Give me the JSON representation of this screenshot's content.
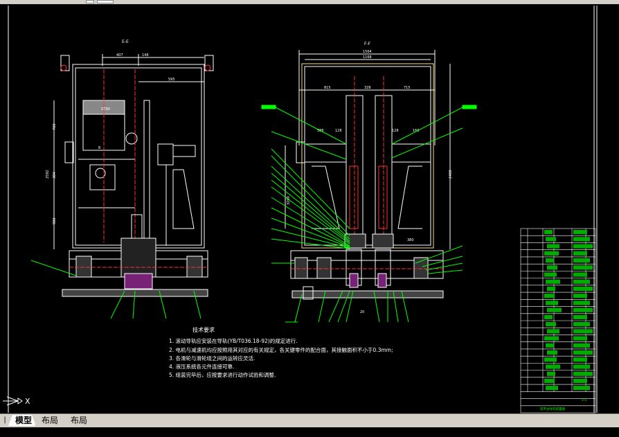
{
  "app": {
    "toolbar_icons": [
      "toolbar-button-icon",
      "toolbar-field"
    ]
  },
  "views": {
    "left_title": "E-E",
    "right_title": "F-F",
    "left_dims": [
      "407",
      "148",
      "595",
      "780",
      "384",
      "2592",
      "980"
    ],
    "right_dims": [
      "1564",
      "1168",
      "815",
      "328",
      "715",
      "588",
      "128",
      "128",
      "160",
      "2400",
      "3200",
      "380",
      "20"
    ],
    "left_labels": [
      "SZ90",
      "8"
    ]
  },
  "notes": {
    "title": "技术要求",
    "items": [
      "1. 滚动导轨应安装在导轨(YB/T036.18-92)的规定进行.",
      "2. 电机与减速机均应按照用其对应的有关规定，各关键零件的配合面，其接触面积不小于0.3mm;",
      "3. 各滑轮与滑轮组之间的运转应灵活.",
      "4. 液压系统各元件连接可靠.",
      "5. 组装完毕后，应按要求进行动作试验和调整."
    ]
  },
  "title_block": {
    "rows": 26,
    "footer": "双平台导向装置图",
    "scale_label": "1:5"
  },
  "ucs": {
    "x_axis": "X"
  },
  "tabs": [
    {
      "label": "模型",
      "active": true
    },
    {
      "label": "布局1",
      "active": false
    },
    {
      "label": "布局2",
      "active": false
    }
  ],
  "colors": {
    "background": "#000000",
    "lines": "#ffffff",
    "callouts": "#00ff00",
    "hidden": "#ff3030",
    "frame": "#ffffff",
    "magenta": "#ff00ff"
  }
}
